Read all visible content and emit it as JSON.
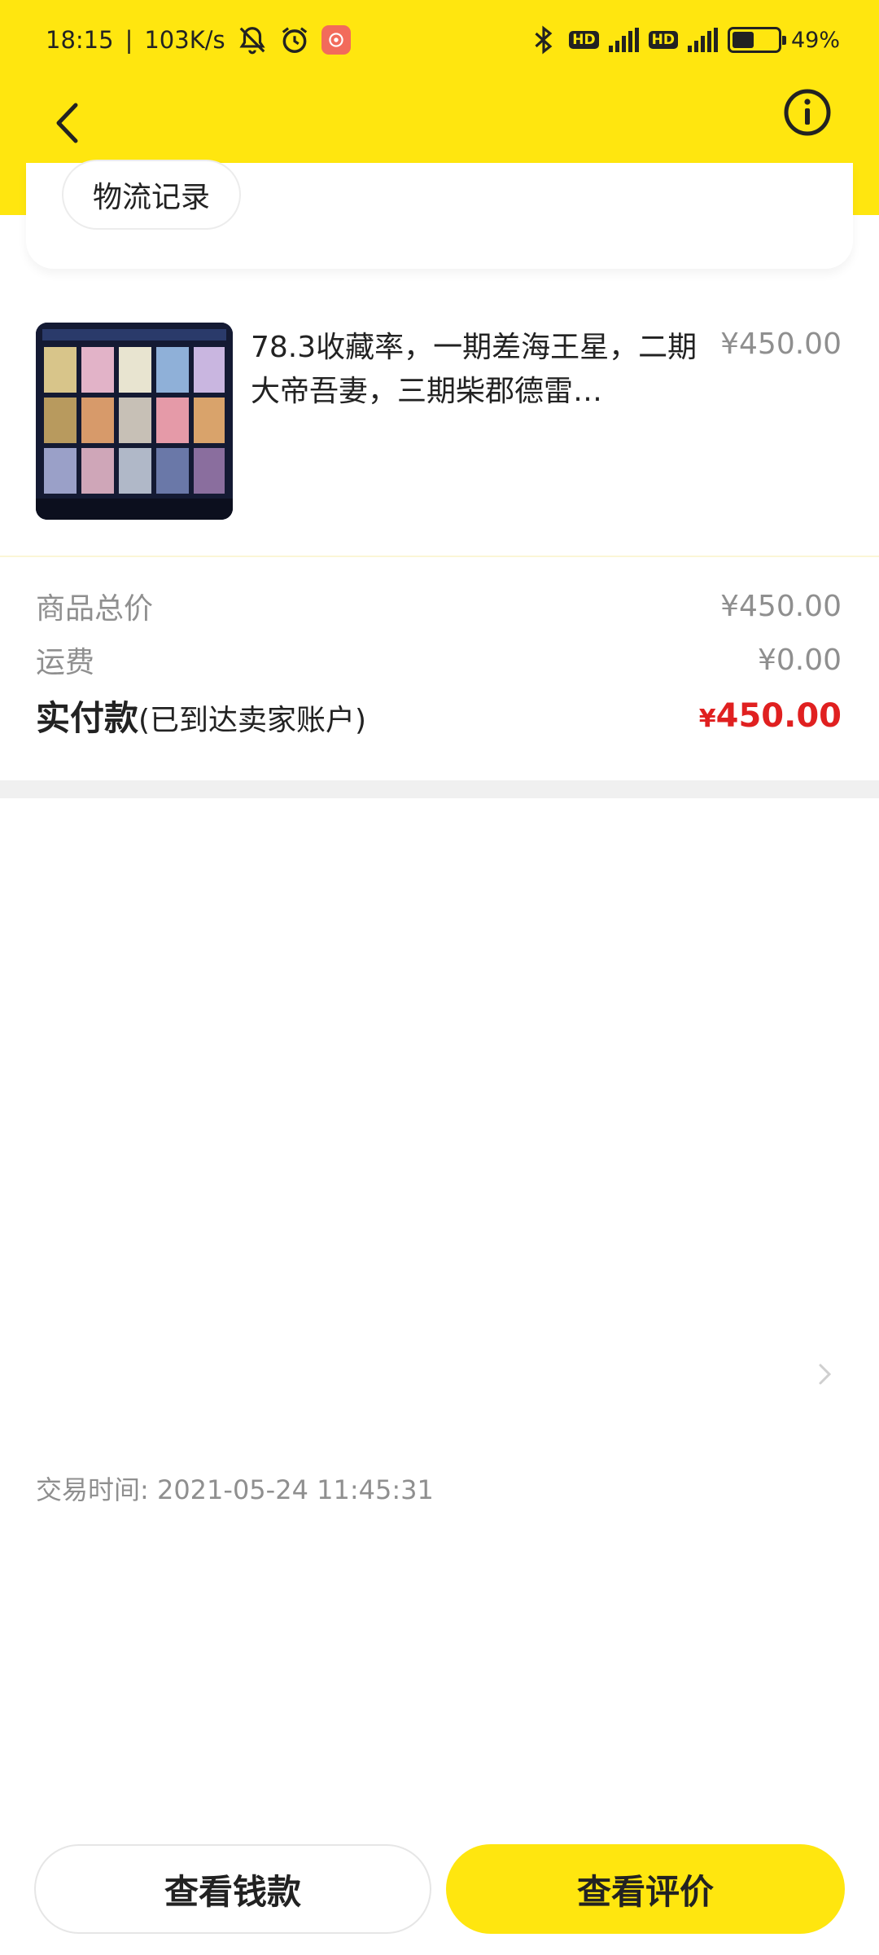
{
  "status_bar": {
    "time": "18:15",
    "net_speed": "103K/s",
    "hd1": "HD",
    "hd2": "HD",
    "net1": "4G",
    "net2": "5G",
    "battery_percent": "49%",
    "battery_level": 0.49,
    "icons": [
      "bell-off-icon",
      "alarm-icon",
      "app-notification-icon",
      "bluetooth-icon",
      "signal-icon",
      "battery-icon"
    ]
  },
  "navbar": {
    "back_icon": "chevron-left-icon",
    "info_icon": "info-icon"
  },
  "logistics": {
    "button_label": "物流记录"
  },
  "product": {
    "title": "78.3收藏率，一期差海王星，二期大帝吾妻，三期柴郡德雷…",
    "price": "¥450.00"
  },
  "summary": {
    "goods_total_label": "商品总价",
    "goods_total_value": "¥450.00",
    "shipping_label": "运费",
    "shipping_value": "¥0.00",
    "paid_label": "实付款",
    "paid_note": "(已到达卖家账户)",
    "paid_currency": "¥",
    "paid_amount": "450.00"
  },
  "trade": {
    "time_text": "交易时间: 2021-05-24 11:45:31"
  },
  "actions": {
    "view_money_label": "查看钱款",
    "view_review_label": "查看评价"
  },
  "colors": {
    "brand_yellow": "#ffe60f",
    "price_red": "#e02020",
    "muted_gray": "#8f8f8f"
  }
}
